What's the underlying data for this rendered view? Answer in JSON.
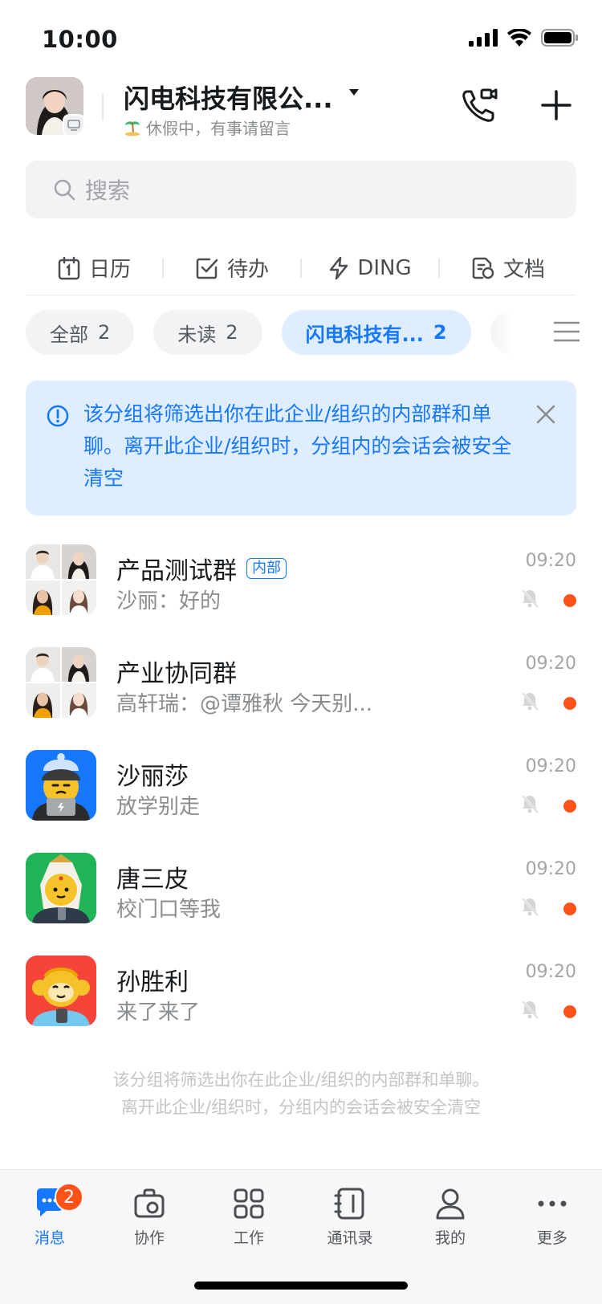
{
  "status_bar": {
    "time": "10:00"
  },
  "header": {
    "org_name": "闪电科技有限公...",
    "status_text": "休假中，有事请留言"
  },
  "search": {
    "placeholder": "搜索"
  },
  "tools": [
    {
      "label": "日历",
      "icon": "calendar-icon"
    },
    {
      "label": "待办",
      "icon": "todo-icon"
    },
    {
      "label": "DING",
      "icon": "ding-icon"
    },
    {
      "label": "文档",
      "icon": "doc-icon"
    }
  ],
  "chips": [
    {
      "label": "全部",
      "count": "2"
    },
    {
      "label": "未读",
      "count": "2"
    },
    {
      "label": "闪电科技有...",
      "count": "2"
    }
  ],
  "notice": {
    "text": "该分组将筛选出你在此企业/组织的内部群和单聊。离开此企业/组织时，分组内的会话会被安全清空"
  },
  "chats": [
    {
      "name": "产品测试群",
      "tag": "内部",
      "message": "沙丽：好的",
      "time": "09:20"
    },
    {
      "name": "产业协同群",
      "message": "高轩瑞：@谭雅秋 今天别...",
      "time": "09:20"
    },
    {
      "name": "沙丽莎",
      "message": "放学别走",
      "time": "09:20"
    },
    {
      "name": "唐三皮",
      "message": "校门口等我",
      "time": "09:20"
    },
    {
      "name": "孙胜利",
      "message": "来了来了",
      "time": "09:20"
    }
  ],
  "footer_note": {
    "line1": "该分组将筛选出你在此企业/组织的内部群和单聊。",
    "line2": "离开此企业/组织时，分组内的会话会被安全清空"
  },
  "tabbar": {
    "items": [
      {
        "label": "消息",
        "badge": "2"
      },
      {
        "label": "协作"
      },
      {
        "label": "工作"
      },
      {
        "label": "通讯录"
      },
      {
        "label": "我的"
      },
      {
        "label": "更多"
      }
    ]
  },
  "colors": {
    "accent": "#1677ff",
    "unread": "#ff5219",
    "notice_bg": "#deedff"
  }
}
